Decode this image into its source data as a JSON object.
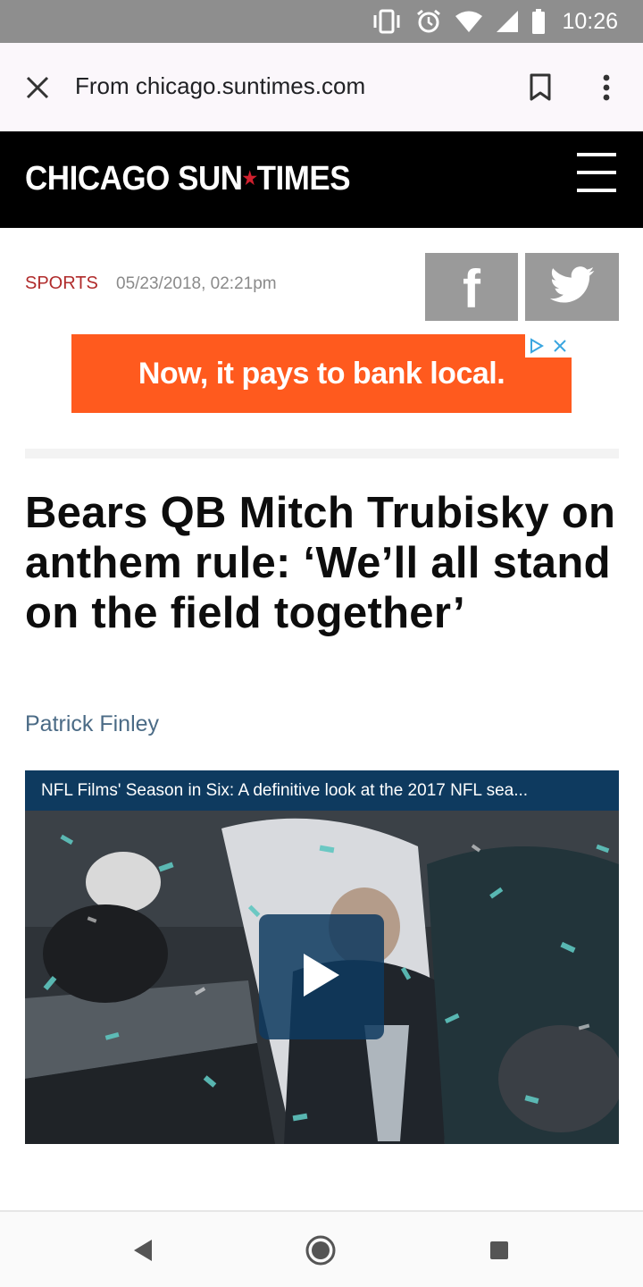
{
  "status_bar": {
    "time": "10:26",
    "icons": [
      "vibrate-icon",
      "alarm-icon",
      "wifi-icon",
      "signal-icon",
      "battery-icon"
    ]
  },
  "toolbar": {
    "url_text": "From chicago.suntimes.com",
    "icons": [
      "close-icon",
      "bookmark-icon",
      "more-vert-icon"
    ]
  },
  "site": {
    "logo_left": "CHICAGO SUN",
    "logo_star": "★",
    "logo_right": "TIMES",
    "menu_icon": "hamburger-icon"
  },
  "article": {
    "section": "SPORTS",
    "date": "05/23/2018, 02:21pm",
    "headline": "Bears QB Mitch Trubisky on anthem rule: ‘We’ll all stand on the field together’",
    "byline": "Patrick Finley"
  },
  "share": {
    "facebook_glyph": "f",
    "icons": [
      "facebook-icon",
      "twitter-icon"
    ]
  },
  "ad": {
    "text": "Now, it pays to bank local.",
    "background": "#ff5a1e"
  },
  "video": {
    "title": "NFL Films' Season in Six: A definitive look at the 2017 NFL sea...",
    "title_bar_color": "#0e3a5f"
  },
  "nav_bar": {
    "icons": [
      "back-icon",
      "home-icon",
      "recents-icon"
    ]
  },
  "colors": {
    "section": "#b02b2b",
    "byline": "#4b6b86",
    "header_bg": "#000000",
    "logo_star": "#d0202e"
  }
}
